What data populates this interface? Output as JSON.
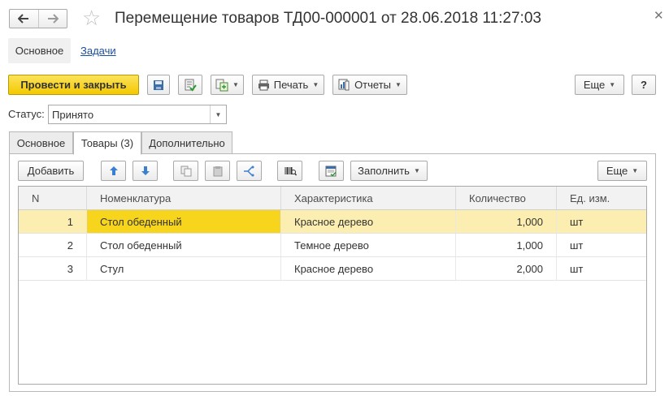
{
  "window": {
    "title": "Перемещение товаров ТД00-000001 от 28.06.2018 11:27:03",
    "back_icon": "arrow-left",
    "forward_icon": "arrow-right",
    "favorite_icon": "star",
    "close_icon": "close"
  },
  "topnav": {
    "main_label": "Основное",
    "tasks_label": "Задачи"
  },
  "toolbar": {
    "post_close_label": "Провести и закрыть",
    "print_label": "Печать",
    "reports_label": "Отчеты",
    "more_label": "Еще",
    "help_label": "?"
  },
  "status": {
    "label": "Статус:",
    "value": "Принято"
  },
  "tabs": [
    {
      "label": "Основное"
    },
    {
      "label": "Товары (3)"
    },
    {
      "label": "Дополнительно"
    }
  ],
  "table_toolbar": {
    "add_label": "Добавить",
    "fill_label": "Заполнить",
    "more_label": "Еще"
  },
  "table": {
    "columns": [
      "N",
      "Номенклатура",
      "Характеристика",
      "Количество",
      "Ед. изм."
    ],
    "rows": [
      {
        "n": "1",
        "name": "Стол обеденный",
        "char": "Красное дерево",
        "qty": "1,000",
        "unit": "шт"
      },
      {
        "n": "2",
        "name": "Стол обеденный",
        "char": "Темное дерево",
        "qty": "1,000",
        "unit": "шт"
      },
      {
        "n": "3",
        "name": "Стул",
        "char": "Красное дерево",
        "qty": "2,000",
        "unit": "шт"
      }
    ]
  },
  "colors": {
    "primary_button": "#f4c800",
    "selected_row": "#fbeeb0",
    "selected_cell": "#f7d51c",
    "link": "#1a4f9c"
  }
}
